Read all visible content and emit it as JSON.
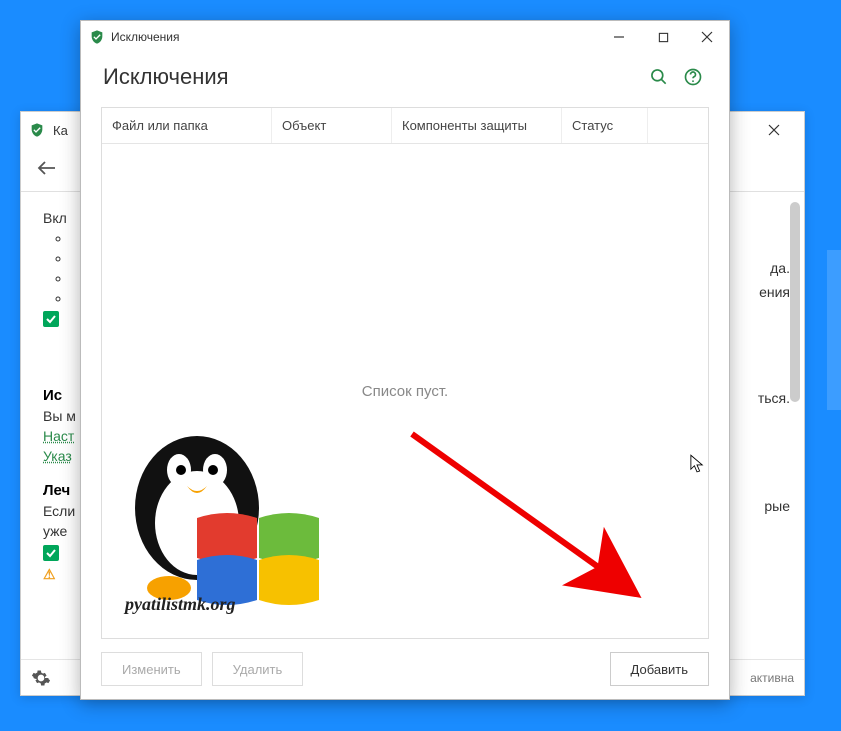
{
  "back": {
    "title": "Ка",
    "body": {
      "line1": "Вкл",
      "section2": "Ис",
      "sec2_line1": "Вы м",
      "link1": "Наст",
      "link2": "Указ",
      "section3": "Леч",
      "sec3_line1": "Если",
      "sec3_line2": "уже"
    },
    "right": {
      "t1": "да.",
      "t2": "ения",
      "t3": "ться.",
      "t4": "рые"
    },
    "footer_status": "активна"
  },
  "front": {
    "window_title": "Исключения",
    "heading": "Исключения",
    "columns": {
      "file": "Файл или папка",
      "object": "Объект",
      "components": "Компоненты защиты",
      "status": "Статус"
    },
    "empty_text": "Список пуст.",
    "buttons": {
      "edit": "Изменить",
      "delete": "Удалить",
      "add": "Добавить"
    }
  },
  "watermark": "pyatilistmk.org"
}
